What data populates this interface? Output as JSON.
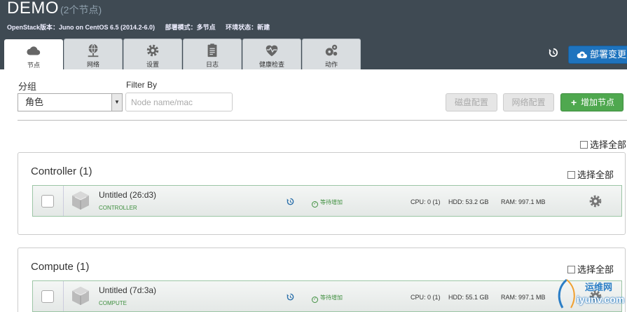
{
  "header": {
    "env_name": "DEMO",
    "node_count": "(2个节点)",
    "info": [
      "OpenStack版本：Juno on CentOS 6.5 (2014.2-6.0)",
      "部署模式：多节点",
      "环境状态：新建"
    ],
    "deploy_label": "部署变更"
  },
  "tabs": [
    {
      "label": "节点",
      "icon": "cloud-icon"
    },
    {
      "label": "网络",
      "icon": "network-icon"
    },
    {
      "label": "设置",
      "icon": "gear-icon"
    },
    {
      "label": "日志",
      "icon": "clipboard-icon"
    },
    {
      "label": "健康检查",
      "icon": "heart-pulse-icon"
    },
    {
      "label": "动作",
      "icon": "cogs-icon"
    }
  ],
  "toolbar": {
    "group_label": "分组",
    "group_value": "角色",
    "filter_label": "Filter By",
    "filter_placeholder": "Node name/mac",
    "disk_config": "磁盘配置",
    "network_config": "网络配置",
    "add_nodes": "增加节点"
  },
  "select_all_label": "选择全部",
  "groups": [
    {
      "title": "Controller (1)",
      "select_all": "选择全部",
      "node": {
        "name": "Untitled (26:d3)",
        "role": "CONTROLLER",
        "status": "等待增加",
        "cpu": "CPU: 0 (1)",
        "hdd": "HDD: 53.2 GB",
        "ram": "RAM: 997.1 MB"
      }
    },
    {
      "title": "Compute (1)",
      "select_all": "选择全部",
      "node": {
        "name": "Untitled (7d:3a)",
        "role": "COMPUTE",
        "status": "等待增加",
        "cpu": "CPU: 0 (1)",
        "hdd": "HDD: 55.1 GB",
        "ram": "RAM: 997.1 MB"
      }
    }
  ],
  "watermark": {
    "line1": "运维网",
    "line2": "iyunv.com"
  },
  "colors": {
    "header_bg": "#3f4a53",
    "deploy_button": "#1e73be",
    "add_button": "#4fa84f",
    "node_border": "#9cc5a5",
    "role_text": "#3f8f3f"
  }
}
